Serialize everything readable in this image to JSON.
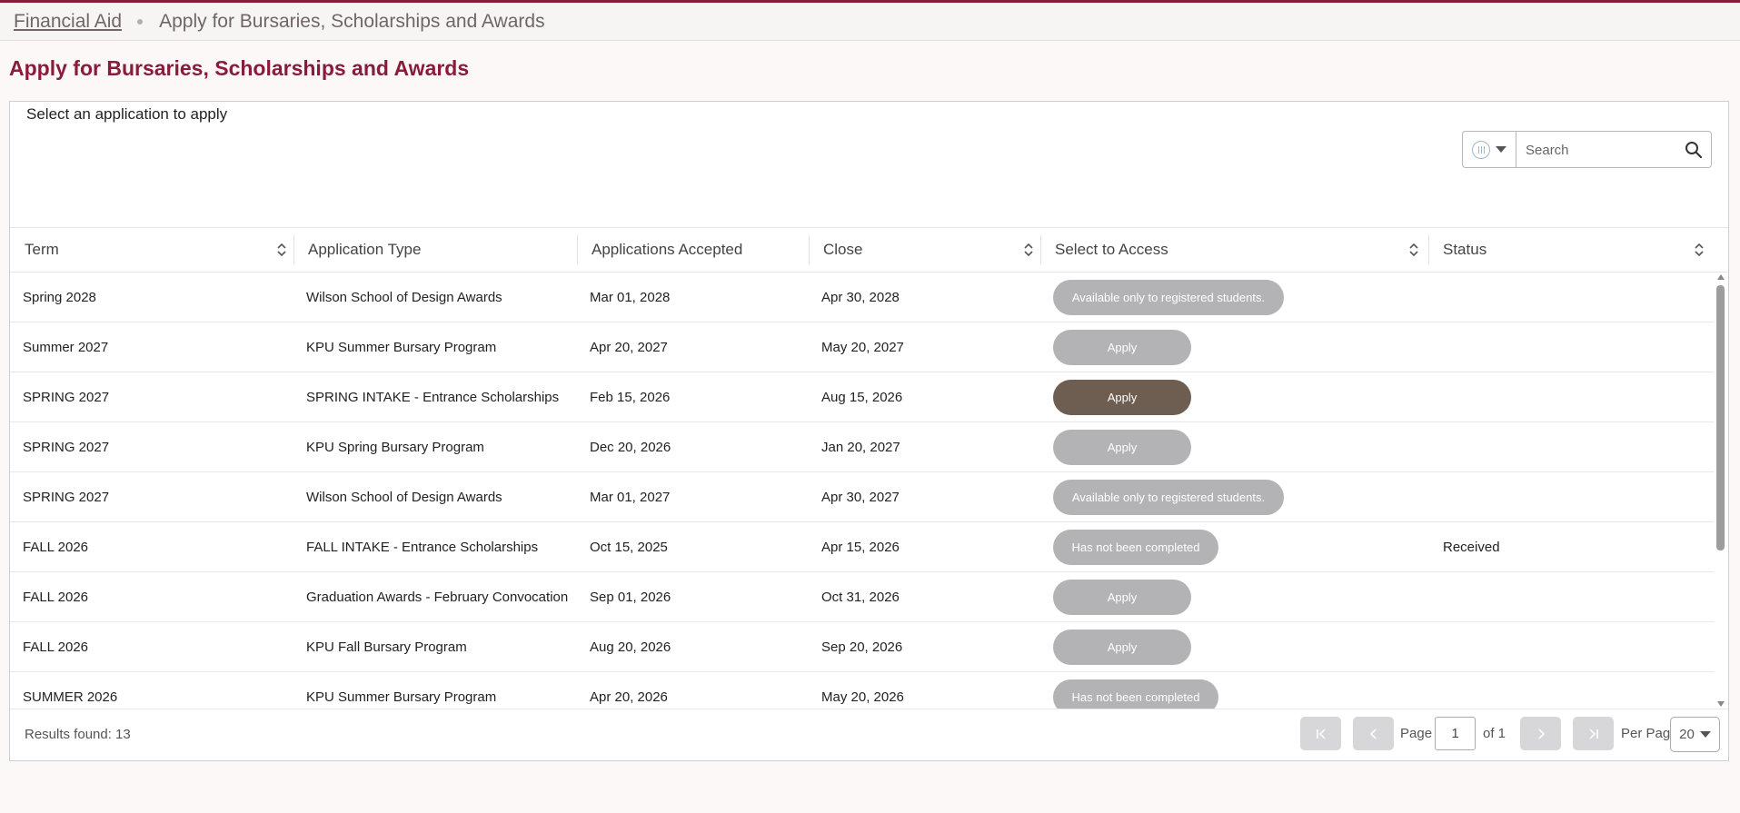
{
  "breadcrumb": {
    "link": "Financial Aid",
    "current": "Apply for Bursaries, Scholarships and Awards"
  },
  "page_title": "Apply for Bursaries, Scholarships and Awards",
  "panel": {
    "subtitle": "Select an application to apply"
  },
  "search": {
    "placeholder": "Search"
  },
  "table": {
    "columns": [
      "Term",
      "Application Type",
      "Applications Accepted",
      "Close",
      "Select to Access",
      "Status"
    ],
    "rows": [
      {
        "term": "Spring 2028",
        "type": "Wilson School of Design Awards",
        "accepted": "Mar 01, 2028",
        "close": "Apr 30, 2028",
        "access": "Available only to registered students.",
        "access_style": "wide",
        "status": ""
      },
      {
        "term": "Summer 2027",
        "type": "KPU Summer Bursary Program",
        "accepted": "Apr 20, 2027",
        "close": "May 20, 2027",
        "access": "Apply",
        "access_style": "apply",
        "status": ""
      },
      {
        "term": "SPRING 2027",
        "type": "SPRING INTAKE - Entrance Scholarships",
        "accepted": "Feb 15, 2026",
        "close": "Aug 15, 2026",
        "access": "Apply",
        "access_style": "apply active",
        "status": ""
      },
      {
        "term": "SPRING 2027",
        "type": "KPU Spring Bursary Program",
        "accepted": "Dec 20, 2026",
        "close": "Jan 20, 2027",
        "access": "Apply",
        "access_style": "apply",
        "status": ""
      },
      {
        "term": "SPRING 2027",
        "type": "Wilson School of Design Awards",
        "accepted": "Mar 01, 2027",
        "close": "Apr 30, 2027",
        "access": "Available only to registered students.",
        "access_style": "wide",
        "status": ""
      },
      {
        "term": "FALL 2026",
        "type": "FALL INTAKE - Entrance Scholarships",
        "accepted": "Oct 15, 2025",
        "close": "Apr 15, 2026",
        "access": "Has not been completed",
        "access_style": "mid",
        "status": "Received"
      },
      {
        "term": "FALL 2026",
        "type": "Graduation Awards - February Convocation",
        "accepted": "Sep 01, 2026",
        "close": "Oct 31, 2026",
        "access": "Apply",
        "access_style": "apply",
        "status": ""
      },
      {
        "term": "FALL 2026",
        "type": "KPU Fall Bursary Program",
        "accepted": "Aug 20, 2026",
        "close": "Sep 20, 2026",
        "access": "Apply",
        "access_style": "apply",
        "status": ""
      },
      {
        "term": "SUMMER 2026",
        "type": "KPU Summer Bursary Program",
        "accepted": "Apr 20, 2026",
        "close": "May 20, 2026",
        "access": "Has not been completed",
        "access_style": "mid",
        "status": ""
      }
    ]
  },
  "footer": {
    "results": "Results found: 13",
    "page_label": "Page",
    "page_value": "1",
    "of_label": "of 1",
    "per_page_label": "Per Page",
    "per_page_value": "20"
  },
  "colors": {
    "brand": "#8a1c3b",
    "active_button": "#6e5e52",
    "disabled_button": "#b3b3b5"
  }
}
